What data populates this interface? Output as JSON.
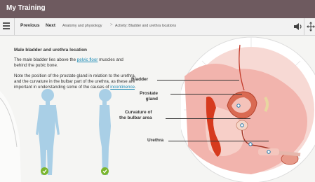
{
  "window": {
    "title": "My Training"
  },
  "nav": {
    "previous_label": "Previous",
    "next_label": "Next",
    "breadcrumb": [
      "Anatomy and physiology",
      "Activity: Bladder and urethra locations"
    ],
    "separator": ">"
  },
  "lesson": {
    "heading": "Male bladder and urethra location",
    "para1_before": "The male bladder lies above the ",
    "para1_link": "pelvic floor",
    "para1_after": " muscles and behind the pubic bone.",
    "para2_before": "Note the position of the prostate gland in relation to the urethra, and the curvature in the bulbar part of the urethra, as these are important in understanding some of the causes of ",
    "para2_link": "incontinence",
    "para2_after": "."
  },
  "labels": {
    "bladder": "Bladder",
    "prostate_1": "Prostate",
    "prostate_2": "gland",
    "curvature_1": "Curvature of",
    "curvature_2": "the bulbar area",
    "urethra": "Urethra"
  },
  "icons": {
    "menu": "hamburger-icon",
    "sound": "speaker-icon",
    "move": "move-arrows-icon",
    "check": "check-icon"
  },
  "colors": {
    "titlebar": "#6e5a5f",
    "link": "#1a8ab5",
    "check": "#7ab52d",
    "figure": "#a9cfe6",
    "tissue": "#f2b4ad",
    "organ": "#d63a1e"
  }
}
